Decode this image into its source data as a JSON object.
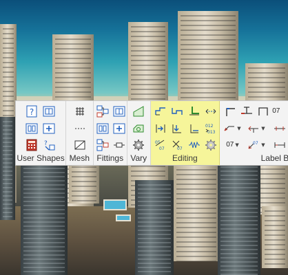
{
  "ribbon": {
    "groups": [
      {
        "id": "user-shapes",
        "label": "User Shapes"
      },
      {
        "id": "mesh",
        "label": "Mesh"
      },
      {
        "id": "fittings",
        "label": "Fittings"
      },
      {
        "id": "vary",
        "label": "Vary"
      },
      {
        "id": "editing",
        "label": "Editing"
      },
      {
        "id": "label-bar",
        "label": "Label Bar"
      }
    ],
    "label_bar": {
      "text_07_top": "07",
      "text_07_bottom": "07"
    }
  },
  "colors": {
    "ribbon_bg": "#f3f3f3",
    "editing_highlight": "#f6f59a",
    "icon_blue": "#1f5fbf",
    "icon_green": "#2e8b2e",
    "icon_red": "#c0392b"
  },
  "icons": [
    "help-shape-icon",
    "shape-library-icon",
    "shape-open-icon",
    "shape-add-icon",
    "calculator-icon",
    "shape-convert-icon",
    "mesh-grid-icon",
    "mesh-dashed-icon",
    "mesh-square-icon",
    "fitting-tee-icon",
    "fitting-book-icon",
    "fitting-open-icon",
    "fitting-add-icon",
    "fitting-reducer-icon",
    "fitting-pipe-icon",
    "vary-ramp-icon",
    "vary-loop-icon",
    "vary-gear-icon",
    "edit-pipe-a-icon",
    "edit-pipe-b-icon",
    "edit-pipe-c-icon",
    "edit-dimension-icon",
    "edit-arrow-right-icon",
    "edit-arrow-down-icon",
    "edit-corner-icon",
    "edit-renumber-icon",
    "edit-renumber-scissors-icon",
    "edit-spring-icon",
    "edit-settings-icon",
    "label-elbow-icon",
    "label-tee-icon",
    "label-bracket-icon",
    "label-arrow-line-icon",
    "label-arrow-fork-icon",
    "label-pipe-icon",
    "label-07-icon"
  ]
}
